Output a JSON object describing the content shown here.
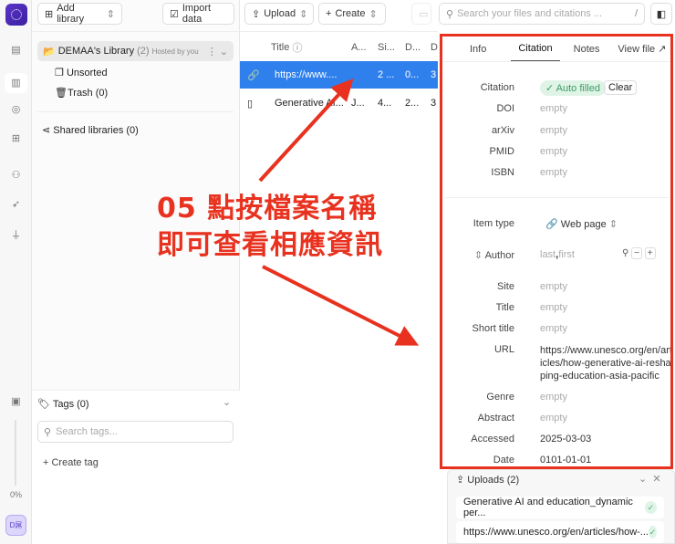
{
  "toolbar": {
    "add_library": "Add library",
    "import_data": "Import data",
    "upload": "Upload",
    "create": "Create",
    "search_placeholder": "Search your files and citations ...",
    "search_shortcut": "/"
  },
  "rail": {
    "progress": "0%",
    "avatar": "D屌"
  },
  "sidebar": {
    "library_name": "DEMAA's Library",
    "library_count": "(2)",
    "library_host": "Hosted by you",
    "unsorted": "Unsorted",
    "trash": "Trash (0)",
    "shared": "Shared libraries (0)",
    "tags_title": "Tags (0)",
    "tags_placeholder": "Search tags...",
    "create_tag": "Create tag"
  },
  "table": {
    "headers": [
      "Title",
      "A...",
      "Si...",
      "D...",
      "D"
    ],
    "rows": [
      {
        "title": "https://www....",
        "author": "",
        "size": "2 ...",
        "date": "0...",
        "d2": "3"
      },
      {
        "title": "Generative AI...",
        "author": "J...",
        "size": "4...",
        "date": "2...",
        "d2": "3"
      }
    ]
  },
  "panel": {
    "tabs": [
      "Info",
      "Citation",
      "Notes",
      "View file ↗"
    ],
    "citation_label": "Citation",
    "auto_filled": "Auto filled",
    "clear": "Clear",
    "ids": [
      {
        "label": "DOI",
        "value": "empty"
      },
      {
        "label": "arXiv",
        "value": "empty"
      },
      {
        "label": "PMID",
        "value": "empty"
      },
      {
        "label": "ISBN",
        "value": "empty"
      }
    ],
    "item_type_label": "Item type",
    "item_type": "Web page",
    "author_label": "Author",
    "author_last": "last",
    "author_first": "first",
    "fields": [
      {
        "label": "Site",
        "value": "empty"
      },
      {
        "label": "Title",
        "value": "empty"
      },
      {
        "label": "Short title",
        "value": "empty"
      },
      {
        "label": "URL",
        "value": "https://www.unesco.org/en/articles/how-generative-ai-reshaping-education-asia-pacific"
      },
      {
        "label": "Genre",
        "value": "empty"
      },
      {
        "label": "Abstract",
        "value": "empty"
      },
      {
        "label": "Accessed",
        "value": "2025-03-03"
      },
      {
        "label": "Date",
        "value": "0101-01-01"
      }
    ]
  },
  "uploads": {
    "title": "Uploads (2)",
    "items": [
      "Generative AI and education_dynamic per...",
      "https://www.unesco.org/en/articles/how-..."
    ]
  },
  "annotation": {
    "line1": "05 點按檔案名稱",
    "line2": "即可查看相應資訊"
  },
  "colors": {
    "accent": "#2f80ed",
    "annotation": "#e8321f",
    "brand": "#4a2bb5"
  }
}
